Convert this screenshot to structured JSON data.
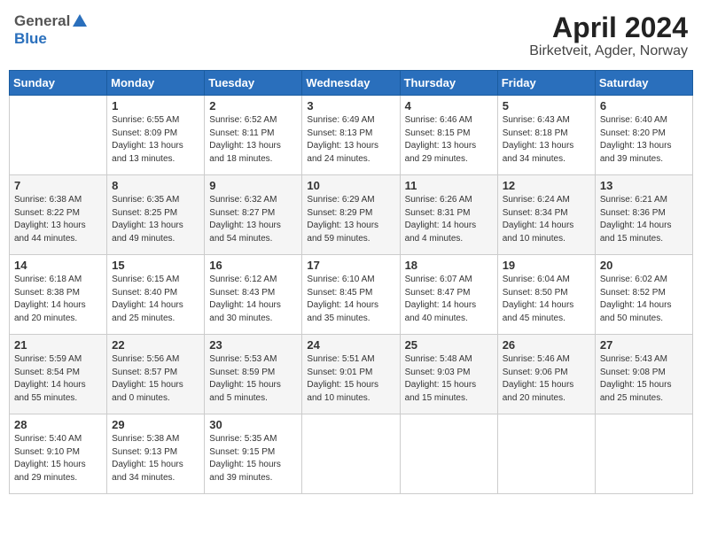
{
  "header": {
    "logo_general": "General",
    "logo_blue": "Blue",
    "month": "April 2024",
    "location": "Birketveit, Agder, Norway"
  },
  "days_of_week": [
    "Sunday",
    "Monday",
    "Tuesday",
    "Wednesday",
    "Thursday",
    "Friday",
    "Saturday"
  ],
  "weeks": [
    [
      {
        "day": "",
        "info": ""
      },
      {
        "day": "1",
        "info": "Sunrise: 6:55 AM\nSunset: 8:09 PM\nDaylight: 13 hours\nand 13 minutes."
      },
      {
        "day": "2",
        "info": "Sunrise: 6:52 AM\nSunset: 8:11 PM\nDaylight: 13 hours\nand 18 minutes."
      },
      {
        "day": "3",
        "info": "Sunrise: 6:49 AM\nSunset: 8:13 PM\nDaylight: 13 hours\nand 24 minutes."
      },
      {
        "day": "4",
        "info": "Sunrise: 6:46 AM\nSunset: 8:15 PM\nDaylight: 13 hours\nand 29 minutes."
      },
      {
        "day": "5",
        "info": "Sunrise: 6:43 AM\nSunset: 8:18 PM\nDaylight: 13 hours\nand 34 minutes."
      },
      {
        "day": "6",
        "info": "Sunrise: 6:40 AM\nSunset: 8:20 PM\nDaylight: 13 hours\nand 39 minutes."
      }
    ],
    [
      {
        "day": "7",
        "info": "Sunrise: 6:38 AM\nSunset: 8:22 PM\nDaylight: 13 hours\nand 44 minutes."
      },
      {
        "day": "8",
        "info": "Sunrise: 6:35 AM\nSunset: 8:25 PM\nDaylight: 13 hours\nand 49 minutes."
      },
      {
        "day": "9",
        "info": "Sunrise: 6:32 AM\nSunset: 8:27 PM\nDaylight: 13 hours\nand 54 minutes."
      },
      {
        "day": "10",
        "info": "Sunrise: 6:29 AM\nSunset: 8:29 PM\nDaylight: 13 hours\nand 59 minutes."
      },
      {
        "day": "11",
        "info": "Sunrise: 6:26 AM\nSunset: 8:31 PM\nDaylight: 14 hours\nand 4 minutes."
      },
      {
        "day": "12",
        "info": "Sunrise: 6:24 AM\nSunset: 8:34 PM\nDaylight: 14 hours\nand 10 minutes."
      },
      {
        "day": "13",
        "info": "Sunrise: 6:21 AM\nSunset: 8:36 PM\nDaylight: 14 hours\nand 15 minutes."
      }
    ],
    [
      {
        "day": "14",
        "info": "Sunrise: 6:18 AM\nSunset: 8:38 PM\nDaylight: 14 hours\nand 20 minutes."
      },
      {
        "day": "15",
        "info": "Sunrise: 6:15 AM\nSunset: 8:40 PM\nDaylight: 14 hours\nand 25 minutes."
      },
      {
        "day": "16",
        "info": "Sunrise: 6:12 AM\nSunset: 8:43 PM\nDaylight: 14 hours\nand 30 minutes."
      },
      {
        "day": "17",
        "info": "Sunrise: 6:10 AM\nSunset: 8:45 PM\nDaylight: 14 hours\nand 35 minutes."
      },
      {
        "day": "18",
        "info": "Sunrise: 6:07 AM\nSunset: 8:47 PM\nDaylight: 14 hours\nand 40 minutes."
      },
      {
        "day": "19",
        "info": "Sunrise: 6:04 AM\nSunset: 8:50 PM\nDaylight: 14 hours\nand 45 minutes."
      },
      {
        "day": "20",
        "info": "Sunrise: 6:02 AM\nSunset: 8:52 PM\nDaylight: 14 hours\nand 50 minutes."
      }
    ],
    [
      {
        "day": "21",
        "info": "Sunrise: 5:59 AM\nSunset: 8:54 PM\nDaylight: 14 hours\nand 55 minutes."
      },
      {
        "day": "22",
        "info": "Sunrise: 5:56 AM\nSunset: 8:57 PM\nDaylight: 15 hours\nand 0 minutes."
      },
      {
        "day": "23",
        "info": "Sunrise: 5:53 AM\nSunset: 8:59 PM\nDaylight: 15 hours\nand 5 minutes."
      },
      {
        "day": "24",
        "info": "Sunrise: 5:51 AM\nSunset: 9:01 PM\nDaylight: 15 hours\nand 10 minutes."
      },
      {
        "day": "25",
        "info": "Sunrise: 5:48 AM\nSunset: 9:03 PM\nDaylight: 15 hours\nand 15 minutes."
      },
      {
        "day": "26",
        "info": "Sunrise: 5:46 AM\nSunset: 9:06 PM\nDaylight: 15 hours\nand 20 minutes."
      },
      {
        "day": "27",
        "info": "Sunrise: 5:43 AM\nSunset: 9:08 PM\nDaylight: 15 hours\nand 25 minutes."
      }
    ],
    [
      {
        "day": "28",
        "info": "Sunrise: 5:40 AM\nSunset: 9:10 PM\nDaylight: 15 hours\nand 29 minutes."
      },
      {
        "day": "29",
        "info": "Sunrise: 5:38 AM\nSunset: 9:13 PM\nDaylight: 15 hours\nand 34 minutes."
      },
      {
        "day": "30",
        "info": "Sunrise: 5:35 AM\nSunset: 9:15 PM\nDaylight: 15 hours\nand 39 minutes."
      },
      {
        "day": "",
        "info": ""
      },
      {
        "day": "",
        "info": ""
      },
      {
        "day": "",
        "info": ""
      },
      {
        "day": "",
        "info": ""
      }
    ]
  ]
}
